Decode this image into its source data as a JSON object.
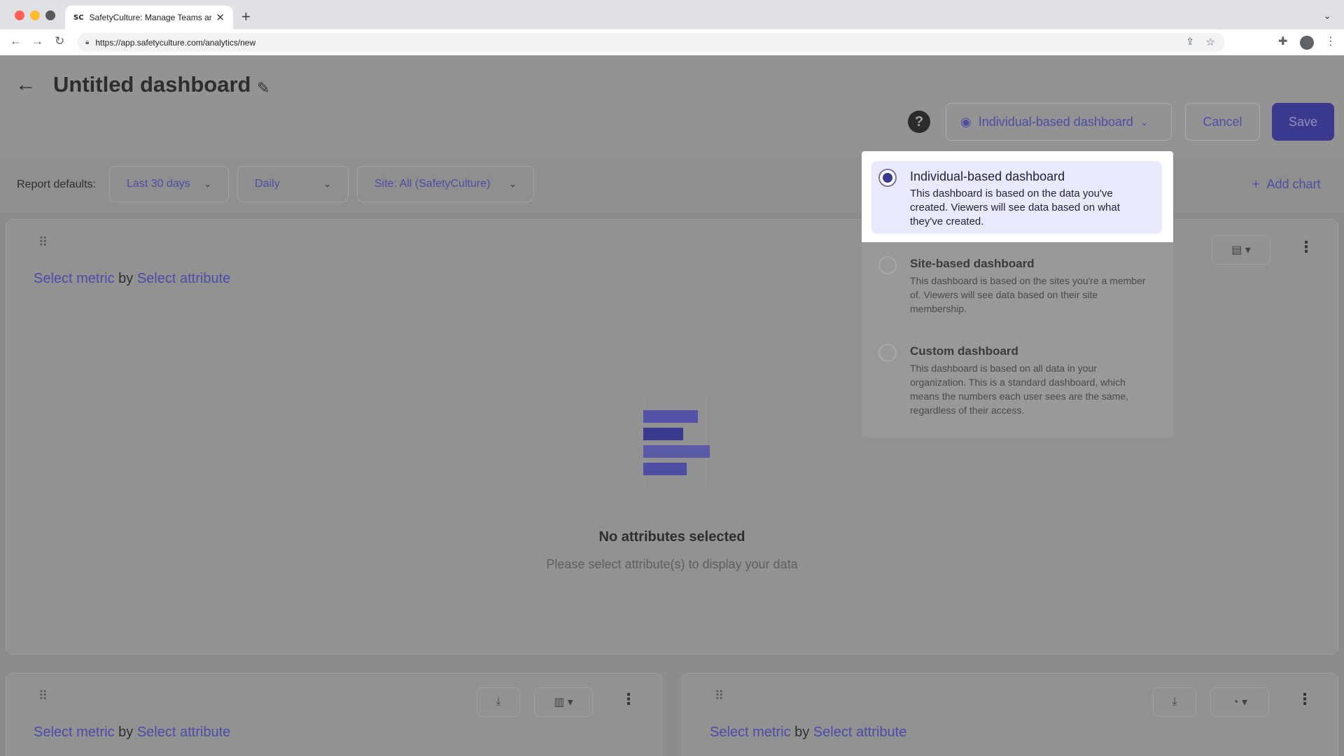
{
  "browser": {
    "tab_title": "SafetyCulture: Manage Teams and ...",
    "tab_favicon": "SC",
    "url": "https://app.safetyculture.com/analytics/new"
  },
  "header": {
    "title": "Untitled dashboard",
    "view_selector_label": "Individual-based dashboard",
    "cancel_label": "Cancel",
    "save_label": "Save",
    "help_label": "?"
  },
  "defaults": {
    "label": "Report defaults:",
    "date_range": "Last 30 days",
    "interval": "Daily",
    "site": "Site: All (SafetyCulture)",
    "add_chart": "Add chart"
  },
  "cards": [
    {
      "metric": "Select metric",
      "by": "by",
      "attribute": "Select attribute"
    },
    {
      "metric": "Select metric",
      "by": "by",
      "attribute": "Select attribute"
    },
    {
      "metric": "Select metric",
      "by": "by",
      "attribute": "Select attribute"
    }
  ],
  "empty_state": {
    "title": "No attributes selected",
    "subtitle": "Please select attribute(s) to display your data"
  },
  "popover": {
    "options": [
      {
        "title": "Individual-based dashboard",
        "description": "This dashboard is based on the data you've created. Viewers will see data based on what they've created.",
        "selected": true
      },
      {
        "title": "Site-based dashboard",
        "description": "This dashboard is based on the sites you're a member of. Viewers will see data based on their site membership.",
        "selected": false
      },
      {
        "title": "Custom dashboard",
        "description": "This dashboard is based on all data in your organization. This is a standard dashboard, which means the numbers each user sees are the same, regardless of their access.",
        "selected": false
      }
    ]
  },
  "colors": {
    "accent": "#3c3a8f",
    "link": "#4b4ba8",
    "selected_option_bg": "#e8e9fc",
    "overlay": "#8c8c8c"
  },
  "icons": {
    "back": "arrow-left-icon",
    "edit": "pencil-icon",
    "help": "question-icon",
    "view": "eye-icon",
    "drag": "drag-handle-icon",
    "download": "download-icon",
    "chart_type": "chart-type-icon",
    "more": "kebab-icon"
  }
}
